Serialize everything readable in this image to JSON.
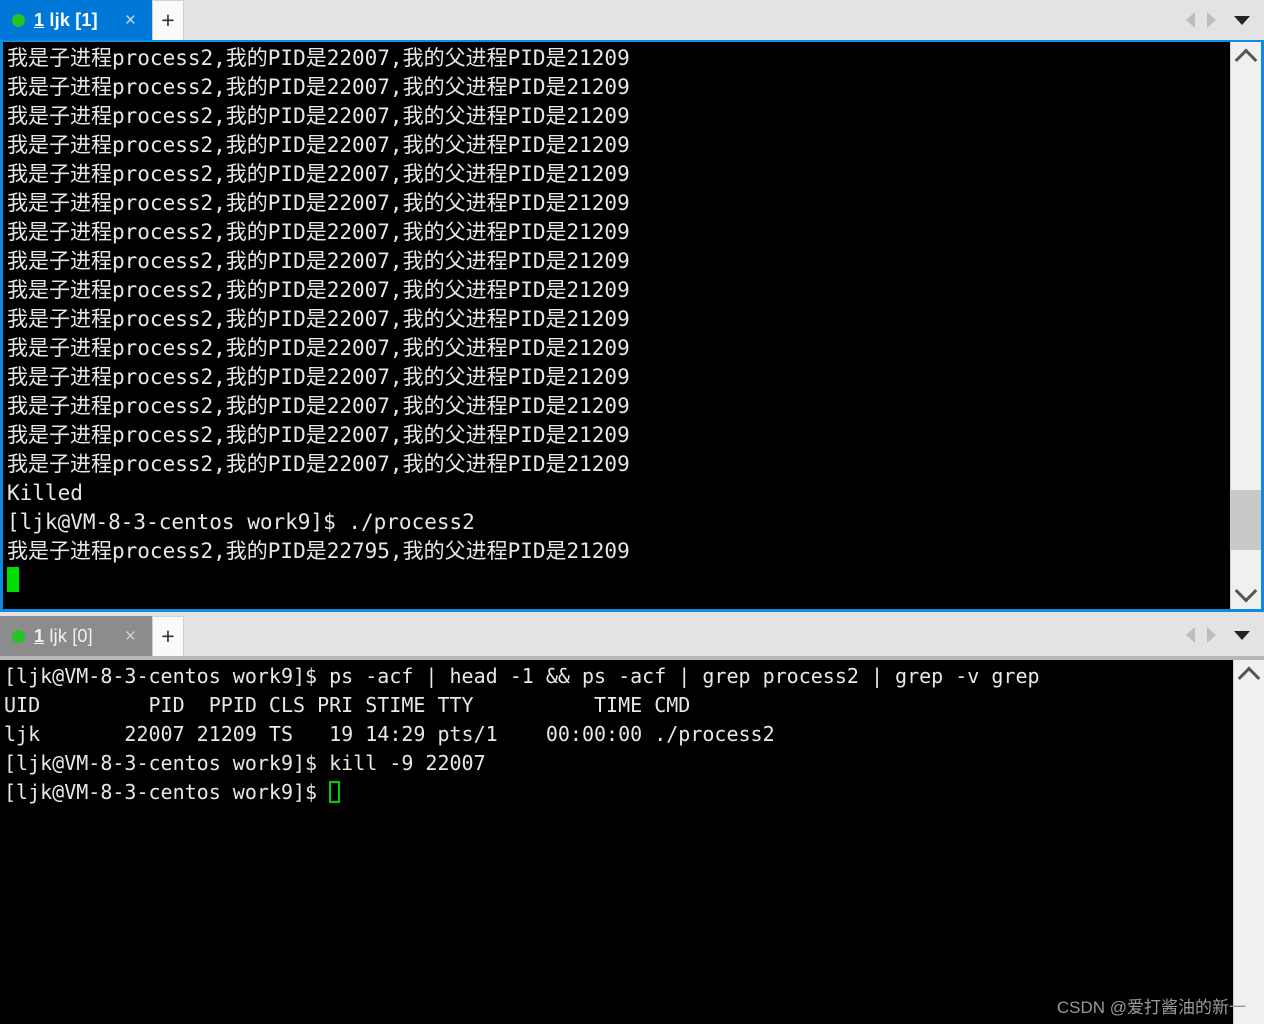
{
  "window": {
    "accent_active_tab": "#0078d7",
    "accent_inactive_tab": "#8c8c8c",
    "terminal_bg": "#000000",
    "terminal_fg": "#e8e8e8",
    "cursor_color": "#00e000"
  },
  "panes": [
    {
      "tab": {
        "number": "1",
        "user": "ljk",
        "index": "[0]",
        "full_label": "1 ljk [1]",
        "status_dot": "green",
        "close_label": "×",
        "new_tab_label": "+",
        "state": "active"
      },
      "nav": {
        "prev_icon": "triangle-left-icon",
        "next_icon": "triangle-right-icon",
        "menu_icon": "caret-down-icon"
      },
      "lines": [
        "我是子进程process2,我的PID是22007,我的父进程PID是21209",
        "我是子进程process2,我的PID是22007,我的父进程PID是21209",
        "我是子进程process2,我的PID是22007,我的父进程PID是21209",
        "我是子进程process2,我的PID是22007,我的父进程PID是21209",
        "我是子进程process2,我的PID是22007,我的父进程PID是21209",
        "我是子进程process2,我的PID是22007,我的父进程PID是21209",
        "我是子进程process2,我的PID是22007,我的父进程PID是21209",
        "我是子进程process2,我的PID是22007,我的父进程PID是21209",
        "我是子进程process2,我的PID是22007,我的父进程PID是21209",
        "我是子进程process2,我的PID是22007,我的父进程PID是21209",
        "我是子进程process2,我的PID是22007,我的父进程PID是21209",
        "我是子进程process2,我的PID是22007,我的父进程PID是21209",
        "我是子进程process2,我的PID是22007,我的父进程PID是21209",
        "我是子进程process2,我的PID是22007,我的父进程PID是21209",
        "我是子进程process2,我的PID是22007,我的父进程PID是21209",
        "Killed",
        "[ljk@VM-8-3-centos work9]$ ./process2",
        "我是子进程process2,我的PID是22795,我的父进程PID是21209"
      ],
      "cursor_style": "block"
    },
    {
      "tab": {
        "number": "1",
        "user": "ljk",
        "index": "[0]",
        "full_label": "1 ljk [0]",
        "status_dot": "green",
        "close_label": "×",
        "new_tab_label": "+",
        "state": "inactive"
      },
      "nav": {
        "prev_icon": "triangle-left-icon",
        "next_icon": "triangle-right-icon",
        "menu_icon": "caret-down-icon"
      },
      "lines": [
        "[ljk@VM-8-3-centos work9]$ ps -acf | head -1 && ps -acf | grep process2 | grep -v grep",
        "UID         PID  PPID CLS PRI STIME TTY          TIME CMD",
        "ljk       22007 21209 TS   19 14:29 pts/1    00:00:00 ./process2",
        "[ljk@VM-8-3-centos work9]$ kill -9 22007",
        "[ljk@VM-8-3-centos work9]$ "
      ],
      "cursor_style": "hollow"
    }
  ],
  "watermark": {
    "text": "CSDN @爱打酱油的新一"
  }
}
